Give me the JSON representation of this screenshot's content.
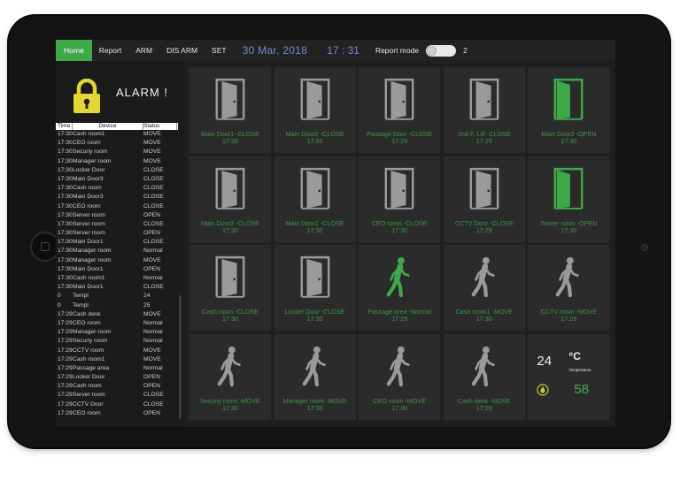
{
  "nav": {
    "items": [
      "Home",
      "Report",
      "ARM",
      "DIS ARM",
      "SET"
    ],
    "date": "30 Mar, 2018",
    "time": "17 : 31",
    "report_mode_label": "Report mode",
    "report_mode_value": "2"
  },
  "alarm": {
    "title": "ALARM !"
  },
  "log": {
    "headers": [
      "Time",
      "Device",
      "Status"
    ],
    "rows": [
      [
        "17:30",
        "Cash room1",
        "MOVE"
      ],
      [
        "17:30",
        "CEO room",
        "MOVE"
      ],
      [
        "17:30",
        "Securiy room",
        "MOVE"
      ],
      [
        "17:30",
        "Manager room",
        "MOVE"
      ],
      [
        "17:30",
        "Locker Door",
        "CLOSE"
      ],
      [
        "17:30",
        "Main Door3",
        "CLOSE"
      ],
      [
        "17:30",
        "Cash room",
        "CLOSE"
      ],
      [
        "17:30",
        "Main Door3",
        "CLOSE"
      ],
      [
        "17:30",
        "CEO room",
        "CLOSE"
      ],
      [
        "17:30",
        "Server room",
        "OPEN"
      ],
      [
        "17:30",
        "Server room",
        "CLOSE"
      ],
      [
        "17:30",
        "Server room",
        "OPEN"
      ],
      [
        "17:30",
        "Main Door1",
        "CLOSE"
      ],
      [
        "17:30",
        "Manager room",
        "Normal"
      ],
      [
        "17:30",
        "Manager room",
        "MOVE"
      ],
      [
        "17:30",
        "Main Door1",
        "OPEN"
      ],
      [
        "17:30",
        "Cash room1",
        "Normal"
      ],
      [
        "17:30",
        "Main Door1",
        "CLOSE"
      ],
      [
        "0",
        "Templ",
        "24"
      ],
      [
        "0",
        "Templ",
        "25"
      ],
      [
        "17:29",
        "Cash desk",
        "MOVE"
      ],
      [
        "17:29",
        "CEO room",
        "Normal"
      ],
      [
        "17:29",
        "Manager room",
        "Normal"
      ],
      [
        "17:29",
        "Securiy room",
        "Normal"
      ],
      [
        "17:29",
        "CCTV room",
        "MOVE"
      ],
      [
        "17:29",
        "Cash room1",
        "MOVE"
      ],
      [
        "17:29",
        "Passage area",
        "Normal"
      ],
      [
        "17:29",
        "Locker Door",
        "OPEN"
      ],
      [
        "17:29",
        "Cash room",
        "OPEN"
      ],
      [
        "17:29",
        "Server room",
        "CLOSE"
      ],
      [
        "17:29",
        "CCTV Door",
        "CLOSE"
      ],
      [
        "17:29",
        "CEO room",
        "OPEN"
      ]
    ]
  },
  "tiles": [
    {
      "kind": "door",
      "state": "closed",
      "label": "Main Door1 -CLOSE",
      "time": "17:30"
    },
    {
      "kind": "door",
      "state": "closed",
      "label": "Main Door2 -CLOSE",
      "time": "17:30"
    },
    {
      "kind": "door",
      "state": "closed",
      "label": "Passage Door -CLOSE",
      "time": "17:29"
    },
    {
      "kind": "door",
      "state": "closed",
      "label": "2nd F. Lift -CLOSE",
      "time": "17:29"
    },
    {
      "kind": "door",
      "state": "open",
      "label": "Main Door2 -OPEN",
      "time": "17:30"
    },
    {
      "kind": "door",
      "state": "closed",
      "label": "Main Door3 -CLOSE",
      "time": "17:30"
    },
    {
      "kind": "door",
      "state": "closed",
      "label": "Main Door1 -CLOSE",
      "time": "17:30"
    },
    {
      "kind": "door",
      "state": "closed",
      "label": "CEO room -CLOSE",
      "time": "17:30"
    },
    {
      "kind": "door",
      "state": "closed",
      "label": "CCTV Door -CLOSE",
      "time": "17:29"
    },
    {
      "kind": "door",
      "state": "open",
      "label": "Server room -OPEN",
      "time": "17:30"
    },
    {
      "kind": "door",
      "state": "closed",
      "label": "Cash room -CLOSE",
      "time": "17:30"
    },
    {
      "kind": "door",
      "state": "closed",
      "label": "Locker Door -CLOSE",
      "time": "17:30"
    },
    {
      "kind": "walk",
      "state": "normal",
      "label": "Passage area -Normal",
      "time": "17:29"
    },
    {
      "kind": "walk",
      "state": "move",
      "label": "Cash room1 -MOVE",
      "time": "17:30"
    },
    {
      "kind": "walk",
      "state": "move",
      "label": "CCTV room -MOVE",
      "time": "17:29"
    },
    {
      "kind": "walk",
      "state": "move",
      "label": "Securiy room -MOVE",
      "time": "17:30"
    },
    {
      "kind": "walk",
      "state": "move",
      "label": "Manager room -MOVE",
      "time": "17:30"
    },
    {
      "kind": "walk",
      "state": "move",
      "label": "CEO room -MOVE",
      "time": "17:30"
    },
    {
      "kind": "walk",
      "state": "move",
      "label": "Cash desk -MOVE",
      "time": "17:29"
    }
  ],
  "climate": {
    "temperature": "24",
    "unit": "°C",
    "caption": "Temperature",
    "humidity": "58"
  },
  "colors": {
    "accent_green": "#3fa94a",
    "icon_gray": "#9a9a9a",
    "date_blue": "#6f8fcf",
    "lock_yellow": "#e3d534"
  }
}
